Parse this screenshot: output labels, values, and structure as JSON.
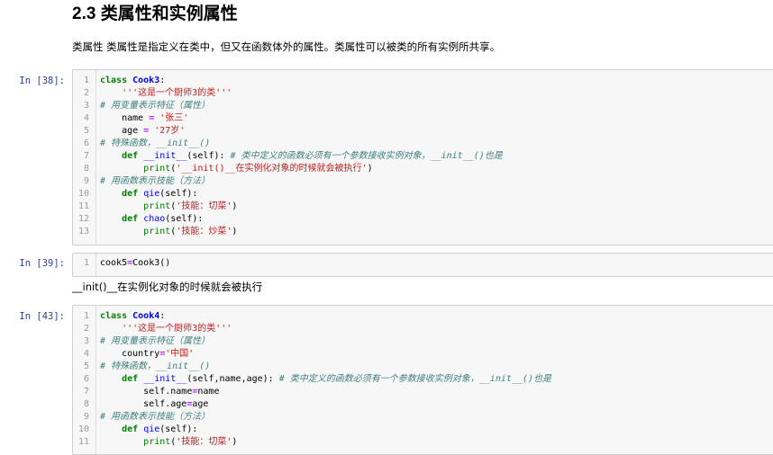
{
  "section": {
    "heading": "2.3 类属性和实例属性",
    "description": "类属性 类属性是指定义在类中，但又在函数体外的属性。类属性可以被类的所有实例所共享。"
  },
  "cells": [
    {
      "prompt": "In [38]:",
      "lines": [
        {
          "n": "1",
          "t": [
            [
              "kw",
              "class "
            ],
            [
              "cls",
              "Cook3"
            ],
            [
              "",
              ":"
            ]
          ]
        },
        {
          "n": "2",
          "t": [
            [
              "",
              "    "
            ],
            [
              "str",
              "'''这是一个厨师3的类'''"
            ]
          ]
        },
        {
          "n": "3",
          "t": [
            [
              "cm",
              "# 用变量表示特征（属性）"
            ]
          ]
        },
        {
          "n": "4",
          "t": [
            [
              "",
              "    name "
            ],
            [
              "op",
              "="
            ],
            [
              "",
              " "
            ],
            [
              "str",
              "'张三'"
            ]
          ]
        },
        {
          "n": "5",
          "t": [
            [
              "",
              "    age "
            ],
            [
              "op",
              "="
            ],
            [
              "",
              " "
            ],
            [
              "str",
              "'27岁'"
            ]
          ]
        },
        {
          "n": "6",
          "t": [
            [
              "cm",
              "# 特殊函数，__init__()"
            ]
          ]
        },
        {
          "n": "7",
          "t": [
            [
              "",
              "    "
            ],
            [
              "kw",
              "def "
            ],
            [
              "fn",
              "__init__"
            ],
            [
              "",
              "(self): "
            ],
            [
              "cm",
              "# 类中定义的函数必须有一个参数接收实例对象，__init__()也是"
            ]
          ]
        },
        {
          "n": "8",
          "t": [
            [
              "",
              "        "
            ],
            [
              "bi",
              "print"
            ],
            [
              "",
              "("
            ],
            [
              "str",
              "'__init()__在实例化对象的时候就会被执行'"
            ],
            [
              "",
              ")"
            ]
          ]
        },
        {
          "n": "9",
          "t": [
            [
              "cm",
              "# 用函数表示技能（方法）"
            ]
          ]
        },
        {
          "n": "10",
          "t": [
            [
              "",
              "    "
            ],
            [
              "kw",
              "def "
            ],
            [
              "fn",
              "qie"
            ],
            [
              "",
              "(self):"
            ]
          ]
        },
        {
          "n": "11",
          "t": [
            [
              "",
              "        "
            ],
            [
              "bi",
              "print"
            ],
            [
              "",
              "("
            ],
            [
              "str",
              "'技能：切菜'"
            ],
            [
              "",
              ")"
            ]
          ]
        },
        {
          "n": "12",
          "t": [
            [
              "",
              "    "
            ],
            [
              "kw",
              "def "
            ],
            [
              "fn",
              "chao"
            ],
            [
              "",
              "(self):"
            ]
          ]
        },
        {
          "n": "13",
          "t": [
            [
              "",
              "        "
            ],
            [
              "bi",
              "print"
            ],
            [
              "",
              "("
            ],
            [
              "str",
              "'技能：炒菜'"
            ],
            [
              "",
              ")"
            ]
          ]
        }
      ]
    },
    {
      "prompt": "In [39]:",
      "lines": [
        {
          "n": "1",
          "t": [
            [
              "",
              "cook5"
            ],
            [
              "op",
              "="
            ],
            [
              "",
              "Cook3()"
            ]
          ]
        }
      ],
      "output": "__init()__在实例化对象的时候就会被执行"
    },
    {
      "prompt": "In [43]:",
      "lines": [
        {
          "n": "1",
          "t": [
            [
              "kw",
              "class "
            ],
            [
              "cls",
              "Cook4"
            ],
            [
              "",
              ":"
            ]
          ]
        },
        {
          "n": "2",
          "t": [
            [
              "",
              "    "
            ],
            [
              "str",
              "'''这是一个厨师3的类'''"
            ]
          ]
        },
        {
          "n": "3",
          "t": [
            [
              "cm",
              "# 用变量表示特征（属性）"
            ]
          ]
        },
        {
          "n": "4",
          "t": [
            [
              "",
              "    country"
            ],
            [
              "op",
              "="
            ],
            [
              "str",
              "'中国'"
            ]
          ]
        },
        {
          "n": "5",
          "t": [
            [
              "cm",
              "# 特殊函数，__init__()"
            ]
          ]
        },
        {
          "n": "6",
          "t": [
            [
              "",
              "    "
            ],
            [
              "kw",
              "def "
            ],
            [
              "fn",
              "__init__"
            ],
            [
              "",
              "(self,name,age): "
            ],
            [
              "cm",
              "# 类中定义的函数必须有一个参数接收实例对象，__init__()也是"
            ]
          ]
        },
        {
          "n": "7",
          "t": [
            [
              "",
              "        self.name"
            ],
            [
              "op",
              "="
            ],
            [
              "",
              "name"
            ]
          ]
        },
        {
          "n": "8",
          "t": [
            [
              "",
              "        self.age"
            ],
            [
              "op",
              "="
            ],
            [
              "",
              "age"
            ]
          ]
        },
        {
          "n": "9",
          "t": [
            [
              "cm",
              "# 用函数表示技能（方法）"
            ]
          ]
        },
        {
          "n": "10",
          "t": [
            [
              "",
              "    "
            ],
            [
              "kw",
              "def "
            ],
            [
              "fn",
              "qie"
            ],
            [
              "",
              "(self):"
            ]
          ]
        },
        {
          "n": "11",
          "t": [
            [
              "",
              "        "
            ],
            [
              "bi",
              "print"
            ],
            [
              "",
              "("
            ],
            [
              "str",
              "'技能：切菜'"
            ],
            [
              "",
              ")"
            ]
          ]
        }
      ]
    }
  ]
}
